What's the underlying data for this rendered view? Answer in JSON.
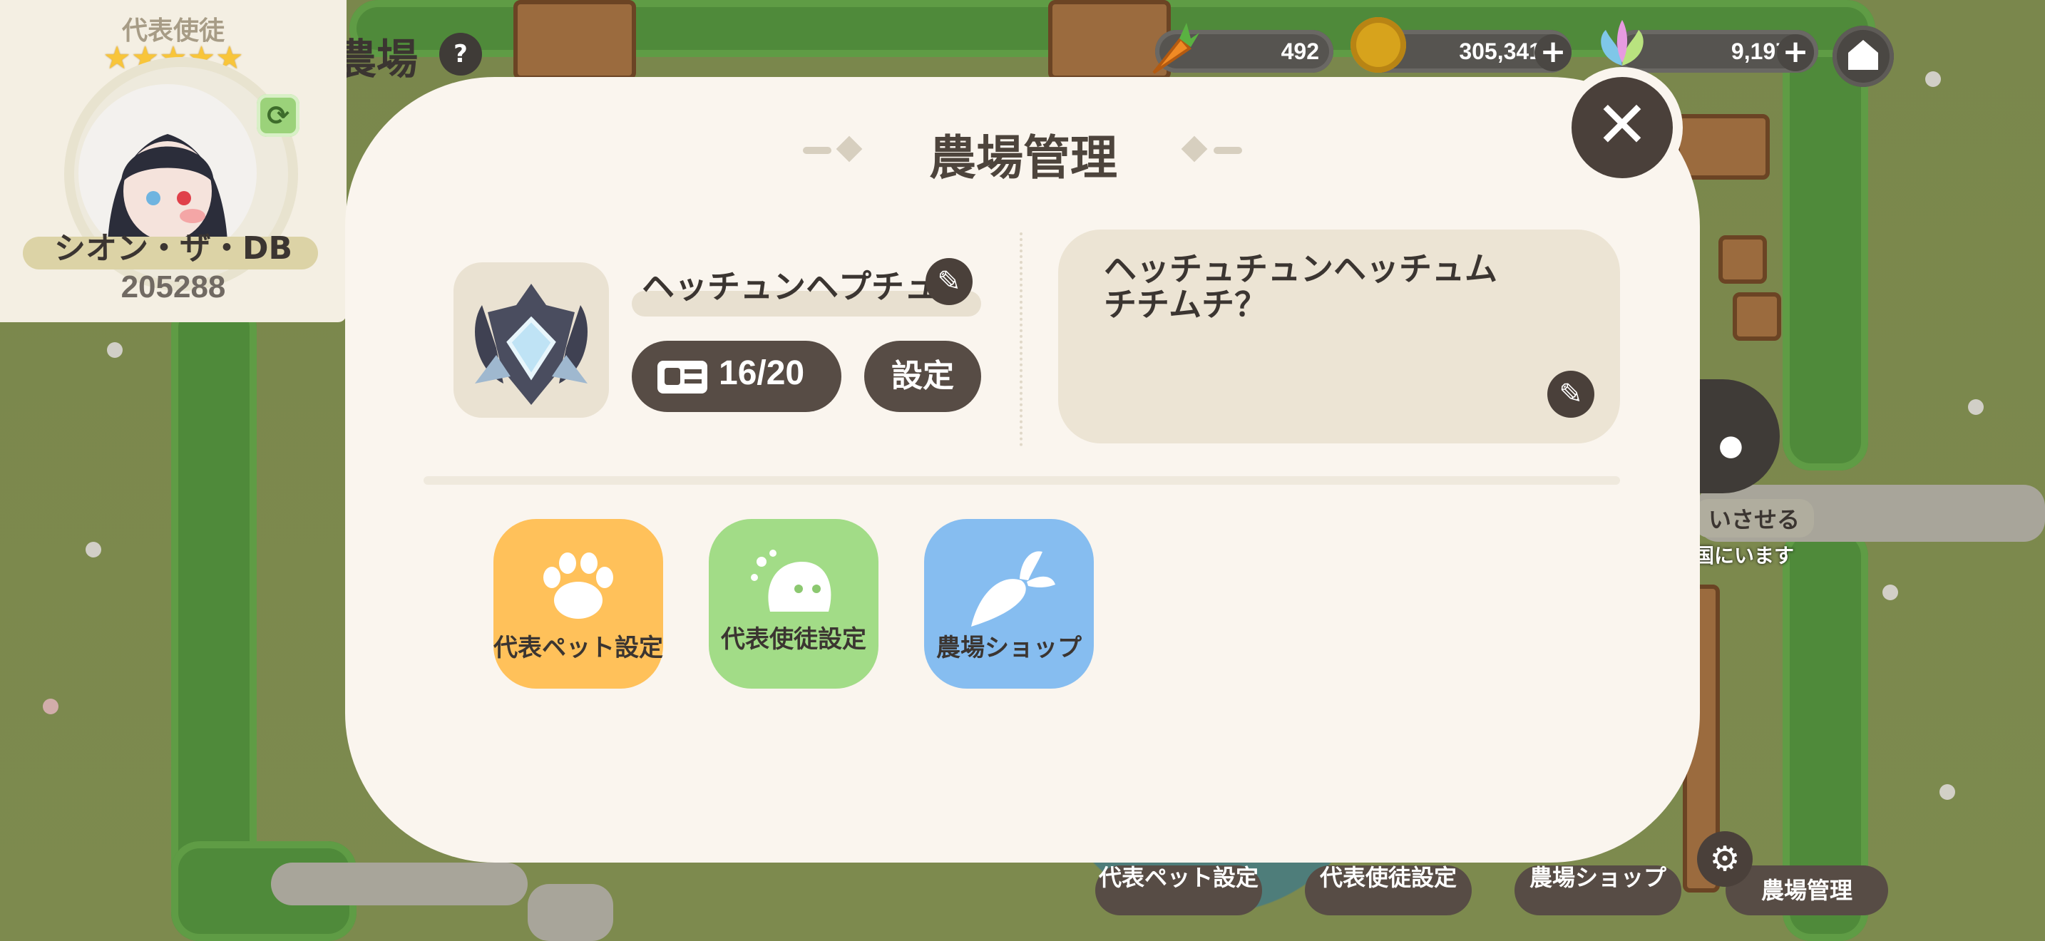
{
  "hud": {
    "carrot": "492",
    "coin": "305,341",
    "gem": "9,197"
  },
  "rep_card": {
    "title": "代表使徒",
    "stars": "★★★★★",
    "name": "シオン・ザ・DB",
    "number": "205288"
  },
  "background": {
    "farm_title": "農場"
  },
  "modal": {
    "title": "農場管理",
    "farm_name": "ヘッチュンヘプチュ",
    "members": "16/20",
    "settings_label": "設定",
    "introduction": "ヘッチュチュンヘッチュムチチムチ？",
    "menu": [
      {
        "label": "代表ペット設定",
        "color": "#ffc15a"
      },
      {
        "label": "代表使徒設定",
        "color": "#a2dc87"
      },
      {
        "label": "農場ショップ",
        "color": "#86bdf0"
      }
    ]
  },
  "bottom_bar": {
    "pet": "代表ペット設定",
    "disciple": "代表使徒設定",
    "shop": "農場ショップ",
    "manage": "農場管理"
  },
  "side": {
    "action": "いさせる",
    "status": "国にいます"
  },
  "colors": {
    "modal_bg": "#faf5ee",
    "dark_button": "#574c45",
    "text_dark": "#3b3531"
  }
}
